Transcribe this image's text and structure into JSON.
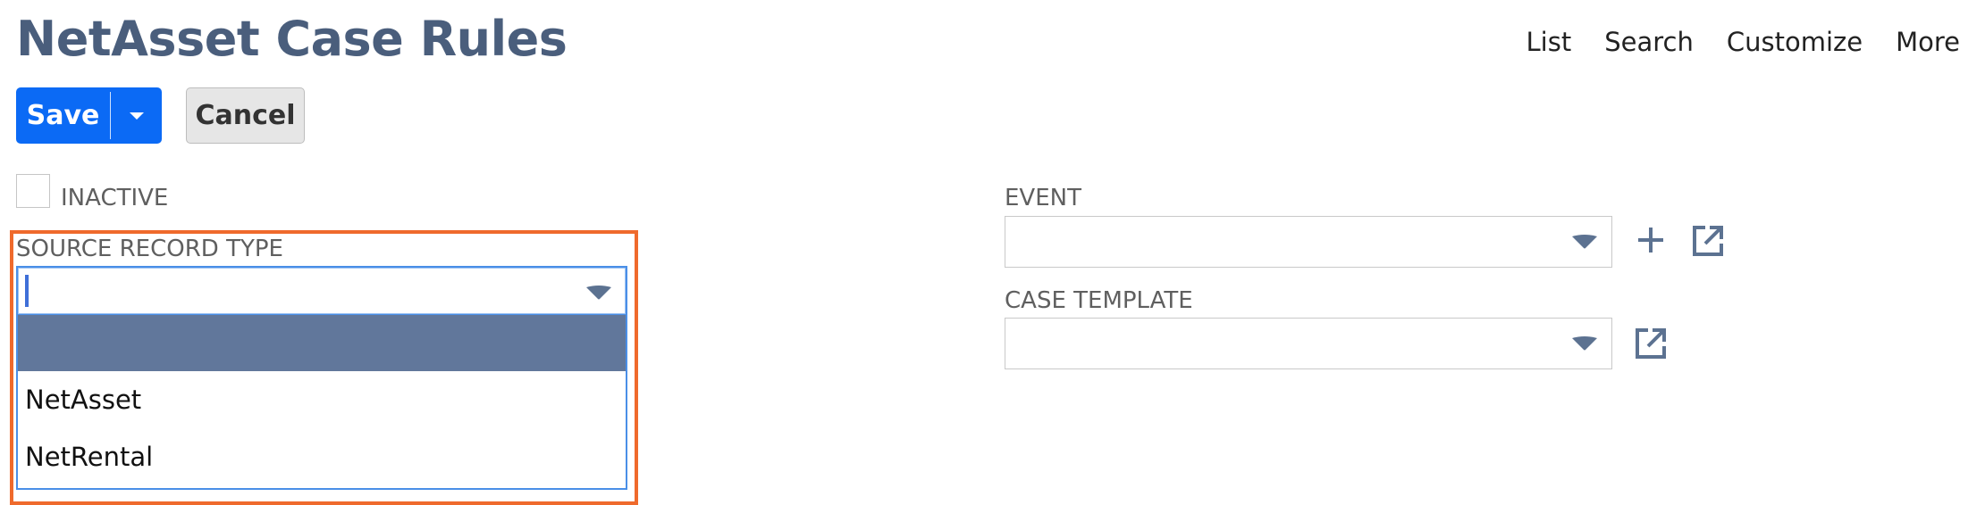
{
  "page": {
    "title": "NetAsset Case Rules"
  },
  "topnav": {
    "items": [
      "List",
      "Search",
      "Customize",
      "More"
    ]
  },
  "toolbar": {
    "save_label": "Save",
    "cancel_label": "Cancel"
  },
  "fields": {
    "inactive": {
      "label": "INACTIVE",
      "checked": false
    },
    "source_record_type": {
      "label": "SOURCE RECORD TYPE",
      "value": "",
      "options": [
        "",
        "NetAsset",
        "NetRental"
      ],
      "highlighted_option": ""
    },
    "event": {
      "label": "EVENT",
      "value": ""
    },
    "case_template": {
      "label": "CASE TEMPLATE",
      "value": ""
    }
  },
  "icons": {
    "dropdown": "chevron-down-icon",
    "add": "plus-icon",
    "open": "open-in-new-icon"
  },
  "colors": {
    "primary": "#0b6af5",
    "title": "#4a5e7c",
    "highlight": "#ef6a2c",
    "selected_option": "#61779b",
    "icon": "#5c7291"
  }
}
